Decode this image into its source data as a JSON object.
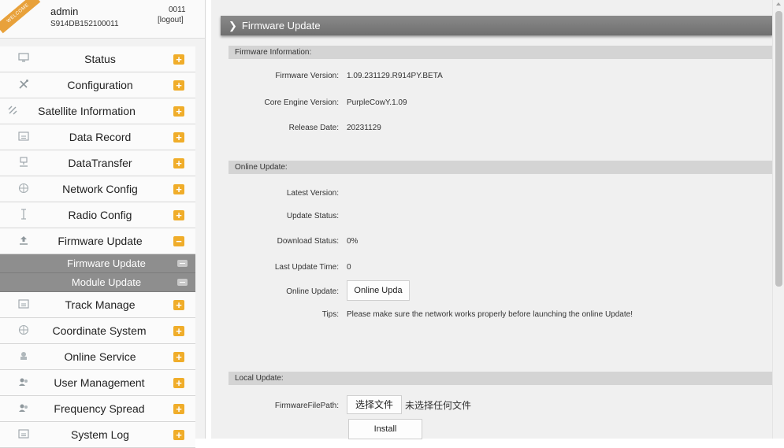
{
  "user": {
    "welcome_ribbon": "WELCOME",
    "name": "admin",
    "serial": "S914DB152100011",
    "code": "0011",
    "logout": "[logout]"
  },
  "nav": {
    "items": [
      {
        "label": "Status",
        "icon": "monitor-icon",
        "toggle": "+"
      },
      {
        "label": "Configuration",
        "icon": "tools-icon",
        "toggle": "+"
      },
      {
        "label": "Satellite Information",
        "icon": "satellite-icon",
        "toggle": "+"
      },
      {
        "label": "Data Record",
        "icon": "calendar-icon",
        "toggle": "+"
      },
      {
        "label": "DataTransfer",
        "icon": "network-icon",
        "toggle": "+"
      },
      {
        "label": "Network Config",
        "icon": "globe-icon",
        "toggle": "+"
      },
      {
        "label": "Radio Config",
        "icon": "antenna-icon",
        "toggle": "+"
      },
      {
        "label": "Firmware Update",
        "icon": "upload-icon",
        "toggle": "−"
      },
      {
        "label": "Track Manage",
        "icon": "calendar-icon",
        "toggle": "+"
      },
      {
        "label": "Coordinate System",
        "icon": "globe-icon",
        "toggle": "+"
      },
      {
        "label": "Online Service",
        "icon": "cloud-icon",
        "toggle": "+"
      },
      {
        "label": "User Management",
        "icon": "users-icon",
        "toggle": "+"
      },
      {
        "label": "Frequency Spread",
        "icon": "users-icon",
        "toggle": "+"
      },
      {
        "label": "System Log",
        "icon": "calendar-icon",
        "toggle": "+"
      }
    ],
    "subitems": [
      {
        "label": "Firmware Update"
      },
      {
        "label": "Module Update"
      }
    ]
  },
  "page": {
    "title": "Firmware Update"
  },
  "firmware_info": {
    "header": "Firmware Information:",
    "firmware_version_label": "Firmware Version:",
    "firmware_version": "1.09.231129.R914PY.BETA",
    "core_engine_label": "Core Engine Version:",
    "core_engine": "PurpleCowY.1.09",
    "release_date_label": "Release Date:",
    "release_date": "20231129"
  },
  "online_update": {
    "header": "Online Update:",
    "latest_version_label": "Latest Version:",
    "latest_version": "",
    "update_status_label": "Update Status:",
    "update_status": "",
    "download_status_label": "Download Status:",
    "download_status": "0%",
    "last_update_label": "Last Update Time:",
    "last_update": "0",
    "online_update_label": "Online Update:",
    "online_update_button": "Online Upda",
    "tips_label": "Tips:",
    "tips": "Please make sure the network works properly before launching the online Update!"
  },
  "local_update": {
    "header": "Local Update:",
    "file_path_label": "FirmwareFilePath:",
    "choose_file_button": "选择文件",
    "no_file_text": "未选择任何文件",
    "install_button": "Install"
  },
  "colors": {
    "accent_orange": "#f0ad2a",
    "title_bar": "#7a7a7a",
    "submenu_bg": "#8e8e8e"
  }
}
